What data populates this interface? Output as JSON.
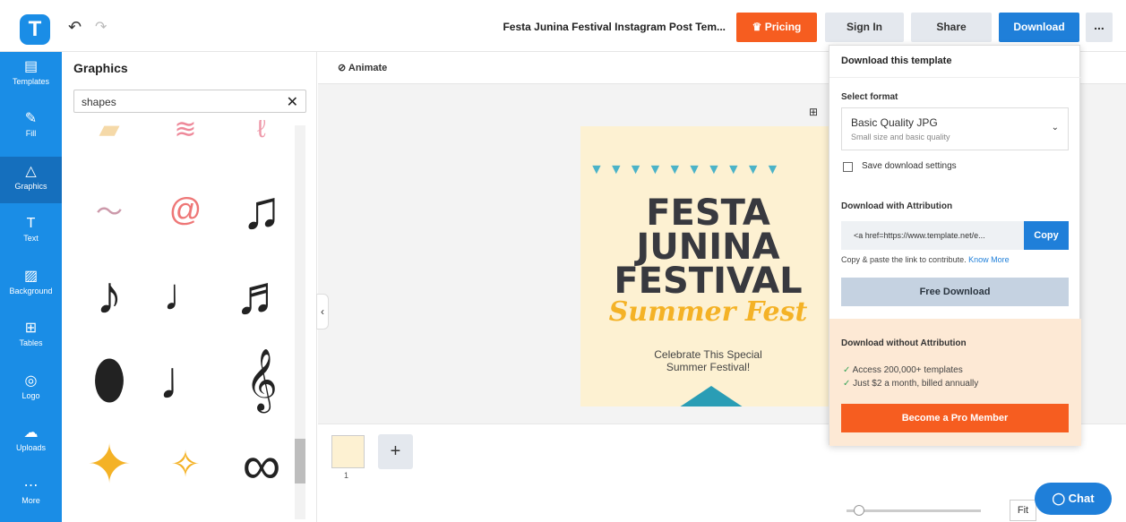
{
  "topbar": {
    "logo_letter": "T",
    "undo_icon": "undo-icon",
    "redo_icon": "redo-icon",
    "title": "Festa Junina Festival Instagram Post Tem...",
    "pricing": "Pricing",
    "signin": "Sign In",
    "share": "Share",
    "download": "Download",
    "more": "..."
  },
  "leftnav": [
    {
      "label": "Templates",
      "icon": "templates-icon"
    },
    {
      "label": "Fill",
      "icon": "fill-icon"
    },
    {
      "label": "Graphics",
      "icon": "graphics-icon"
    },
    {
      "label": "Text",
      "icon": "text-icon"
    },
    {
      "label": "Background",
      "icon": "background-icon"
    },
    {
      "label": "Tables",
      "icon": "tables-icon"
    },
    {
      "label": "Logo",
      "icon": "logo-icon"
    },
    {
      "label": "Uploads",
      "icon": "uploads-icon"
    },
    {
      "label": "More",
      "icon": "more-icon"
    }
  ],
  "panel": {
    "title": "Graphics",
    "search_value": "shapes",
    "clear_icon": "close-icon"
  },
  "canvas": {
    "animate": "Animate",
    "poster": {
      "line1": "FESTA",
      "line2": "JUNINA",
      "line3": "FESTIVAL",
      "script": "Summer Fest",
      "sub1": "Celebrate This Special",
      "sub2": "Summer Festival!"
    },
    "page_number": "1",
    "add_page": "+",
    "fit": "Fit"
  },
  "popup": {
    "header": "Download this template",
    "select_format": "Select format",
    "format_title": "Basic Quality JPG",
    "format_sub": "Small size and basic quality",
    "save_settings": "Save download settings",
    "with_attr": "Download with Attribution",
    "attr_code": "<a href=https://www.template.net/e...",
    "copy": "Copy",
    "attr_text": "Copy & paste the link to contribute.",
    "know_more": "Know More",
    "free_download": "Free Download",
    "without_attr": "Download without Attribution",
    "benefit1": "Access 200,000+ templates",
    "benefit2": "Just $2 a month, billed annually",
    "pro": "Become a Pro Member"
  },
  "chat": "Chat",
  "colors": {
    "accent": "#1a8de6",
    "orange": "#f65d20",
    "blue_btn": "#1f7fd9"
  }
}
